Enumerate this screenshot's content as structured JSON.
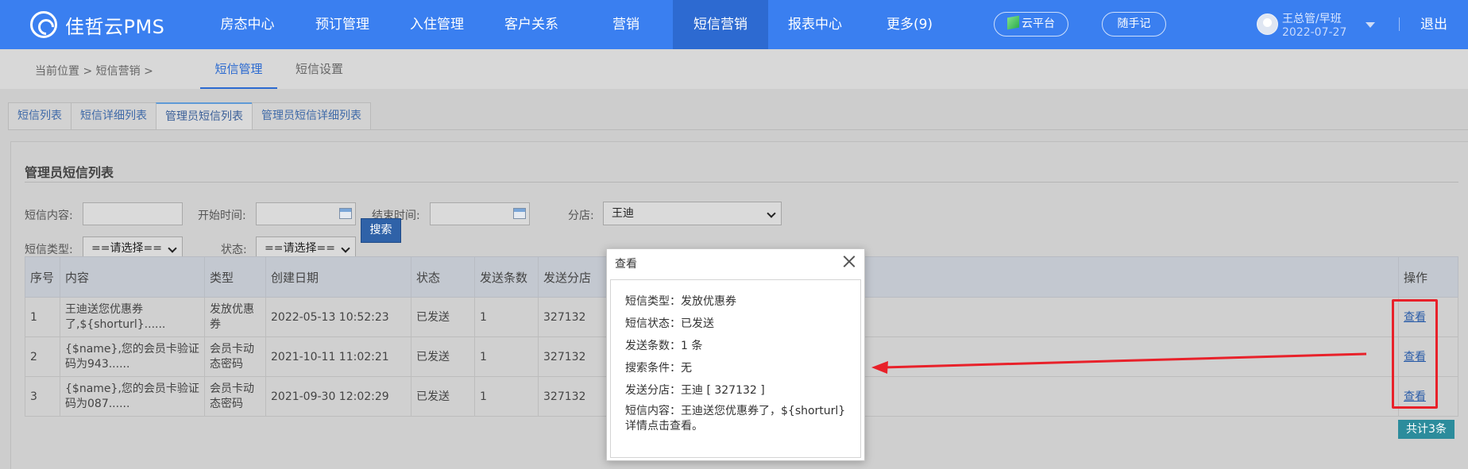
{
  "brand": {
    "name": "佳哲云PMS"
  },
  "nav": {
    "items": [
      "房态中心",
      "预订管理",
      "入住管理",
      "客户关系",
      "营销",
      "短信营销",
      "报表中心",
      "更多(9)"
    ],
    "active_index": 5
  },
  "header": {
    "cloud_label": "云平台",
    "notes_label": "随手记",
    "user_name": "王总管/早班",
    "user_date": "2022-07-27",
    "logout_label": "退出"
  },
  "breadcrumb": {
    "text": "当前位置 > 短信营销 >",
    "tabs": [
      "短信管理",
      "短信设置"
    ],
    "active_tab": 0
  },
  "tabs": {
    "items": [
      "短信列表",
      "短信详细列表",
      "管理员短信列表",
      "管理员短信详细列表"
    ],
    "active_index": 2
  },
  "panel": {
    "title": "管理员短信列表"
  },
  "filters": {
    "content_label": "短信内容:",
    "content_value": "",
    "start_label": "开始时间:",
    "start_value": "",
    "end_label": "结束时间:",
    "end_value": "",
    "branch_label": "分店:",
    "branch_value": "王迪",
    "type_label": "短信类型:",
    "type_value": "==请选择==",
    "status_label": "状态:",
    "status_value": "==请选择==",
    "search_label": "搜索"
  },
  "table": {
    "columns": [
      "序号",
      "内容",
      "类型",
      "创建日期",
      "状态",
      "发送条数",
      "发送分店",
      "操作"
    ],
    "rows": [
      {
        "no": "1",
        "content": "王迪送您优惠券了,${shorturl}......",
        "type": "发放优惠券",
        "date": "2022-05-13 10:52:23",
        "status": "已发送",
        "count": "1",
        "branch": "327132",
        "action": "查看"
      },
      {
        "no": "2",
        "content": "{$name},您的会员卡验证码为943......",
        "type": "会员卡动态密码",
        "date": "2021-10-11 11:02:21",
        "status": "已发送",
        "count": "1",
        "branch": "327132",
        "action": "查看"
      },
      {
        "no": "3",
        "content": "{$name},您的会员卡验证码为087......",
        "type": "会员卡动态密码",
        "date": "2021-09-30 12:02:29",
        "status": "已发送",
        "count": "1",
        "branch": "327132",
        "action": "查看"
      }
    ],
    "total_label": "共计3条"
  },
  "modal": {
    "title": "查看",
    "lines": [
      "短信类型：发放优惠券",
      "短信状态：已发送",
      "发送条数：1 条",
      "搜索条件：无",
      "发送分店：王迪 [ 327132 ]",
      "短信内容：王迪送您优惠券了，${shorturl}详情点击查看。"
    ]
  },
  "colors": {
    "nav_bg": "#3a7ff0",
    "nav_active": "#2d6ad1",
    "highlight": "#e8212a",
    "link": "#2a5ca8",
    "search_button": "#2f62a8"
  }
}
